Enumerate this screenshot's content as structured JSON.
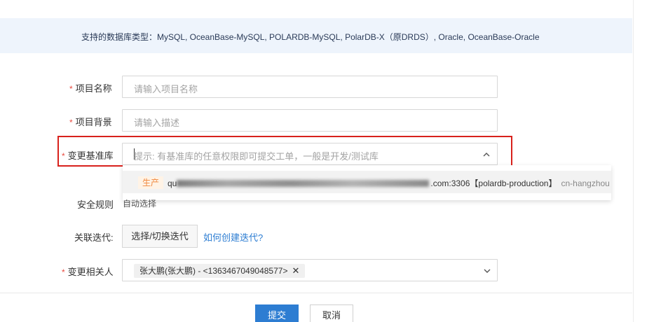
{
  "info_bar": {
    "text": "支持的数据库类型：MySQL, OceanBase-MySQL, POLARDB-MySQL, PolarDB-X（原DRDS）, Oracle, OceanBase-Oracle"
  },
  "form": {
    "required_mark": "*",
    "project_name": {
      "label": "项目名称",
      "placeholder": "请输入项目名称"
    },
    "project_background": {
      "label": "项目背景",
      "placeholder": "请输入描述"
    },
    "base_db": {
      "label": "变更基准库",
      "placeholder": "提示: 有基准库的任意权限即可提交工单，一般是开发/测试库",
      "dropdown_option": {
        "tag": "生产",
        "prefix": "qu",
        "suffix": ".com:3306【polardb-production】",
        "region": "cn-hangzhou"
      }
    },
    "security_rule": {
      "label": "安全规则",
      "value": "自动选择"
    },
    "iteration": {
      "label": "关联迭代:",
      "button": "选择/切换迭代",
      "help_link": "如何创建迭代?"
    },
    "related_people": {
      "label": "变更相关人",
      "selected": "张大鹏(张大鹏) - <1363467049048577>",
      "remove_glyph": "✕"
    }
  },
  "actions": {
    "submit": "提交",
    "cancel": "取消"
  },
  "colors": {
    "primary": "#2d7dd2",
    "required": "#e84a3f",
    "highlight": "#d8211c",
    "prod_tag": "#f0883e"
  }
}
